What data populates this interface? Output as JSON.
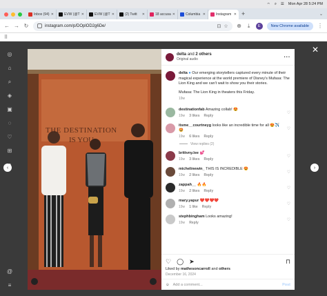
{
  "menubar": {
    "datetime": "Mon Apr 28  5:24 PM"
  },
  "tabs": [
    {
      "label": "Inbox (94)",
      "color": "#d93025"
    },
    {
      "label": "EVW (@T",
      "color": "#111111"
    },
    {
      "label": "EVW (@T",
      "color": "#111111"
    },
    {
      "label": "(2) Twitt",
      "color": "#111111"
    },
    {
      "label": "18 accusa",
      "color": "#e0245e"
    },
    {
      "label": "Columbia",
      "color": "#1d4ed8"
    },
    {
      "label": "Instagram",
      "color": "#e1306c",
      "active": true
    }
  ],
  "address": {
    "url": "instagram.com/p/DOplOD2g6De/",
    "avatar_letter": "E",
    "new_chrome": "New Chrome available"
  },
  "photo": {
    "sign_top": "THE DESTINATION",
    "sign_bottom": "IS YOU"
  },
  "post": {
    "header_user": "delta",
    "header_and": "and",
    "header_others": "2 others",
    "audio": "Original audio",
    "caption_user": "delta",
    "caption_text": "Our emerging storytellers captured every minute of their magical experience at the world premiere of Disney's Mufasa: The Lion King and we can't wait to show you their stories.",
    "caption_text2": "Mufasa: The Lion King in theaters this Friday.",
    "caption_age": "19w",
    "likes_prefix": "Liked by",
    "likes_user": "mathesoncarroll",
    "likes_and": "and",
    "likes_others": "others",
    "date": "December 16, 2024",
    "add_comment": "Add a comment...",
    "post_button": "Post"
  },
  "comments": [
    {
      "user": "destinationfab",
      "text": "Amazing collab! 😍",
      "age": "19w",
      "likes": "3 likes",
      "reply": "Reply",
      "avatar": "#9ab8a0"
    },
    {
      "user": "itsme__courtneyg",
      "text": "looks like an incredible time for all 😍✈️🤩",
      "age": "19w",
      "likes": "6 likes",
      "reply": "Reply",
      "avatar": "#d99aa8",
      "replies": "View replies (2)"
    },
    {
      "user": "brittvny.lee",
      "text": "💕",
      "age": "19w",
      "likes": "3 likes",
      "reply": "Reply",
      "avatar": "#8b3a4a"
    },
    {
      "user": "michelinewin_",
      "text": "THIS IS INCREDIBLE 😍",
      "age": "19w",
      "likes": "2 likes",
      "reply": "Reply",
      "avatar": "#6a4a3a"
    },
    {
      "user": "zappah__",
      "text": "🔥🔥",
      "age": "19w",
      "likes": "2 likes",
      "reply": "Reply",
      "avatar": "#2a2a2a"
    },
    {
      "user": "mary.yapur",
      "text": "❤️❤️❤️❤️",
      "age": "19w",
      "likes": "1 like",
      "reply": "Reply",
      "avatar": "#b0b0b0"
    },
    {
      "user": "stephbingham",
      "text": "Looks amazing!",
      "age": "19w",
      "likes": "",
      "reply": "Reply",
      "avatar": "#c9c9c9"
    }
  ],
  "colors": {
    "instagram_bg": "#3a3a3a",
    "photo_wall": "#b8582f",
    "post_button": "#b3d4fc"
  }
}
